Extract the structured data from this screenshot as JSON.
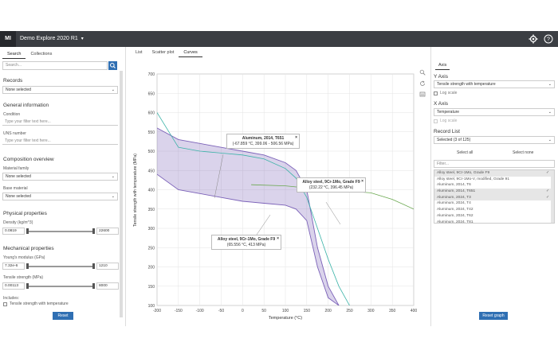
{
  "app": {
    "logo": "MI",
    "title": "Demo Explore 2020 R1",
    "caret": "▾",
    "settings_icon": "gear-icon",
    "help_icon": "help-icon"
  },
  "left": {
    "tabs": [
      "Search",
      "Collections"
    ],
    "search_placeholder": "Search...",
    "sections": {
      "records": "Records",
      "general": "General information",
      "composition": "Composition overview",
      "physical": "Physical properties",
      "mechanical": "Mechanical properties"
    },
    "records_select": "None selected",
    "condition_label": "Condition",
    "condition_placeholder": "Type your filter text here...",
    "uns_label": "UNS number",
    "uns_placeholder": "Type your filter text here...",
    "material_family_label": "Material family",
    "material_family_value": "None selected",
    "base_material_label": "Base material",
    "base_material_value": "None selected",
    "density_label": "Density (kg/m^3)",
    "density_min": "0.0819",
    "density_max": "22600",
    "youngs_label": "Young's modulus (GPa)",
    "youngs_min": "7.32e-6",
    "youngs_max": "1210",
    "tensile_label": "Tensile strength (MPa)",
    "tensile_min": "0.00113",
    "tensile_max": "8000",
    "includes_label": "Includes:",
    "includes_item": "Tensile strength with temperature",
    "reset_label": "Reset"
  },
  "mid": {
    "tabs": [
      "List",
      "Scatter plot",
      "Curves"
    ],
    "active_tab": "Curves",
    "icons": [
      "zoom-icon",
      "refresh-icon",
      "export-icon"
    ],
    "labels": [
      {
        "title": "Aluminum, 2014, T651",
        "coords": "(-67.859 °C, 399.06 - 506.56 MPa)"
      },
      {
        "title": "Alloy steel, 9Cr-1Mo, Grade F9",
        "coords": "(232.22 °C, 396.45 MPa)"
      },
      {
        "title": "Alloy steel, 9Cr-1Mo, Grade F9",
        "coords": "(65.556 °C, 413 MPa)"
      }
    ]
  },
  "chart_data": {
    "type": "line",
    "xlabel": "Temperature (°C)",
    "ylabel": "Tensile strength with temperature (MPa)",
    "xlim": [
      -200,
      400
    ],
    "ylim": [
      100,
      700
    ],
    "xticks": [
      -200,
      -150,
      -100,
      -50,
      0,
      50,
      100,
      150,
      200,
      250,
      300,
      350,
      400
    ],
    "yticks": [
      100,
      150,
      200,
      250,
      300,
      350,
      400,
      450,
      500,
      550,
      600,
      650,
      700
    ],
    "grid": true,
    "band": {
      "name": "Aluminum, 2014, T651",
      "color": "#7b61b8",
      "x": [
        -200,
        -150,
        -100,
        -50,
        0,
        50,
        100,
        125,
        150,
        175,
        200,
        225
      ],
      "upper": [
        560,
        530,
        520,
        510,
        500,
        490,
        470,
        450,
        400,
        250,
        150,
        100
      ],
      "lower": [
        440,
        400,
        390,
        380,
        370,
        365,
        360,
        350,
        320,
        200,
        120,
        100
      ]
    },
    "series": [
      {
        "name": "Alloy steel, 9Cr-1Mo, Grade F9",
        "color": "#6aa84f",
        "x": [
          20,
          100,
          200,
          250,
          300,
          350,
          400
        ],
        "y": [
          413,
          410,
          399,
          396,
          392,
          375,
          350
        ]
      },
      {
        "name": "Aluminum, 2014, T6",
        "color": "#3bb3a8",
        "x": [
          -200,
          -150,
          -100,
          -50,
          0,
          50,
          100,
          125,
          150,
          175,
          200,
          225,
          250
        ],
        "y": [
          600,
          510,
          500,
          495,
          490,
          480,
          455,
          430,
          380,
          300,
          220,
          150,
          100
        ]
      }
    ]
  },
  "right": {
    "tab": "Axis",
    "y_axis_label": "Y Axis",
    "y_axis_value": "Tensile strength with temperature",
    "y_log": "Log scale",
    "x_axis_label": "X Axis",
    "x_axis_value": "Temperature",
    "x_log": "Log scale",
    "record_list_label": "Record List",
    "record_list_value": "Selected (3 of 125)",
    "select_all": "Select all",
    "select_none": "Select none",
    "filter_placeholder": "Filter...",
    "records": [
      {
        "name": "Alloy steel, 9Cr-1Mo, Grade F9",
        "selected": true
      },
      {
        "name": "Alloy steel, 9Cr-1Mo-V, modified, Grade 91",
        "selected": false
      },
      {
        "name": "Aluminum, 2014, T6",
        "selected": false
      },
      {
        "name": "Aluminum, 2014, T651",
        "selected": true
      },
      {
        "name": "Aluminum, 2024, T3",
        "selected": true
      },
      {
        "name": "Aluminum, 2024, T4",
        "selected": false
      },
      {
        "name": "Aluminum, 2024, T42",
        "selected": false
      },
      {
        "name": "Aluminum, 2024, T62",
        "selected": false
      },
      {
        "name": "Aluminum, 2024, T81",
        "selected": false
      },
      {
        "name": "Aluminum, 2024, T351",
        "selected": false
      }
    ],
    "reset_graph": "Reset graph"
  }
}
